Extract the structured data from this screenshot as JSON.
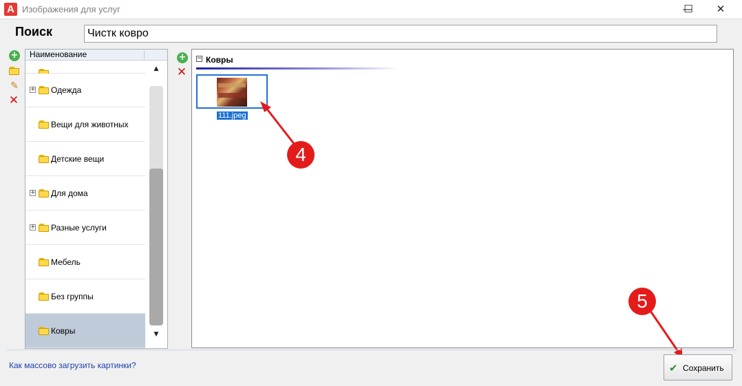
{
  "window": {
    "title": "Изображения для услуг",
    "app_icon_letter": "A",
    "minimize": "—",
    "maximize": "☐",
    "close": "✕"
  },
  "search": {
    "label": "Поиск",
    "value": "Чистк ковро"
  },
  "left_toolbar": {
    "icons": [
      "add-icon",
      "folder-icon",
      "pencil-icon",
      "delete-icon"
    ]
  },
  "tree": {
    "column_header": "Наименование",
    "items": [
      {
        "label": "Одежда",
        "expandable": true,
        "selected": false
      },
      {
        "label": "Вещи для животных",
        "expandable": false,
        "selected": false
      },
      {
        "label": "Детские вещи",
        "expandable": false,
        "selected": false
      },
      {
        "label": "Для дома",
        "expandable": true,
        "selected": false
      },
      {
        "label": "Разные услуги",
        "expandable": true,
        "selected": false
      },
      {
        "label": "Мебель",
        "expandable": false,
        "selected": false
      },
      {
        "label": "Без группы",
        "expandable": false,
        "selected": false
      },
      {
        "label": "Ковры",
        "expandable": false,
        "selected": true
      }
    ]
  },
  "images": {
    "group_title": "Ковры",
    "files": [
      {
        "name": "111.jpeg",
        "selected": true
      }
    ]
  },
  "annotations": {
    "marker_4": "4",
    "marker_5": "5",
    "color": "#e41b1b"
  },
  "footer": {
    "help_link": "Как массово загрузить картинки?",
    "save_label": "Сохранить"
  }
}
